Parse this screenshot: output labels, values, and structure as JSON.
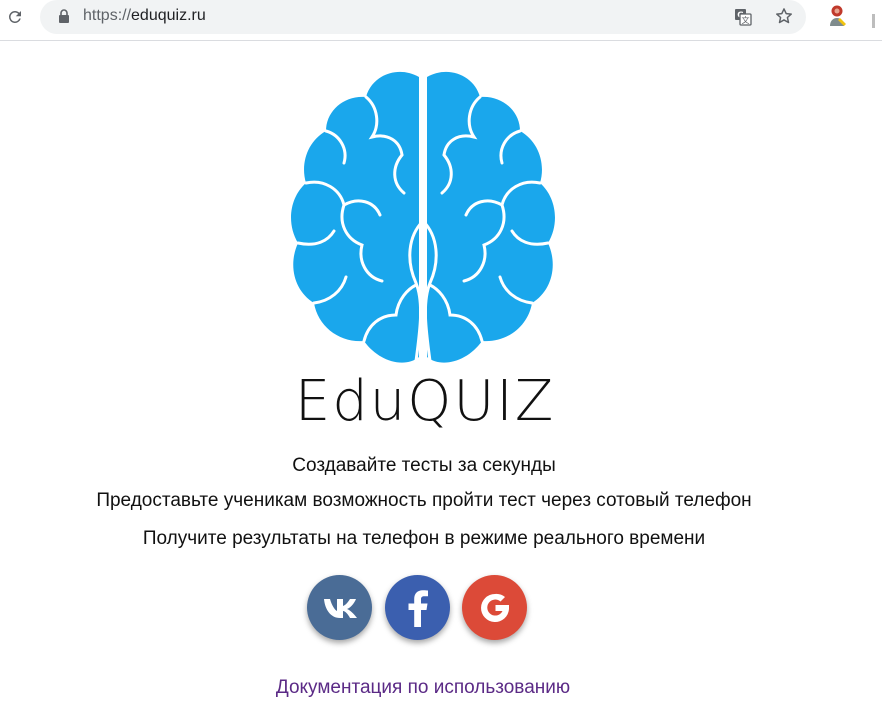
{
  "browser": {
    "url_scheme": "https://",
    "url_host": "eduquiz.ru"
  },
  "brand": {
    "name": "EduQUIZ",
    "brain_color": "#1aa7ec"
  },
  "taglines": [
    "Создавайте тесты за секунды",
    "Предоставьте ученикам возможность пройти тест через сотовый телефон",
    "Получите результаты на телефон в режиме реального времени"
  ],
  "social": {
    "vk_color": "#4a6c96",
    "facebook_color": "#3b5faf",
    "google_color": "#dc4a38"
  },
  "footer": {
    "doc_link": "Документация по использованию"
  }
}
